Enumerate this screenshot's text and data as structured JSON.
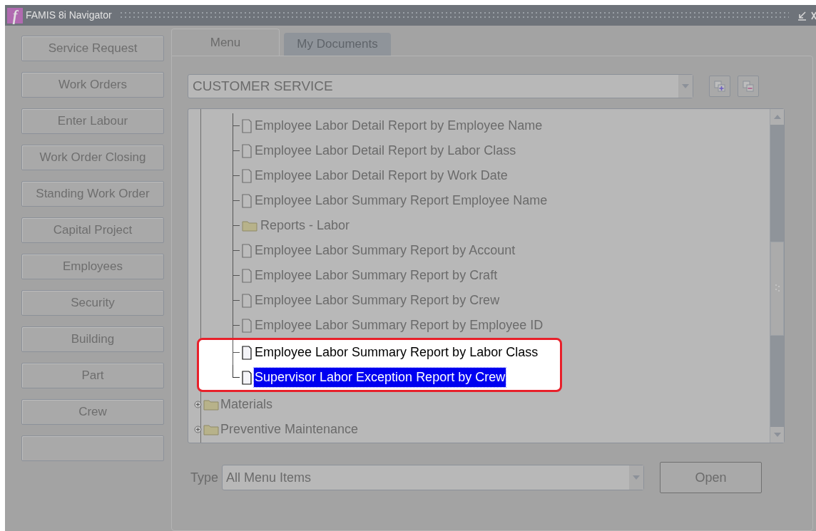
{
  "window": {
    "title": "FAMIS 8i Navigator",
    "logo": "f"
  },
  "sidebar": {
    "items": [
      {
        "kind": "button",
        "label": "Service Request"
      },
      {
        "kind": "button",
        "label": "Work Orders"
      },
      {
        "kind": "button",
        "label": "Enter Labour"
      },
      {
        "kind": "button",
        "label": "Work Order Closing"
      },
      {
        "kind": "button",
        "label": "Standing Work Order"
      },
      {
        "kind": "button",
        "label": "Capital Project"
      },
      {
        "kind": "button",
        "label": "Employees"
      },
      {
        "kind": "button",
        "label": "Security"
      },
      {
        "kind": "button",
        "label": "Building"
      },
      {
        "kind": "button",
        "label": "Part"
      },
      {
        "kind": "button",
        "label": "Crew"
      },
      {
        "kind": "blank"
      }
    ]
  },
  "tabs": [
    {
      "label": "Menu",
      "selected": true
    },
    {
      "label": "My Documents",
      "selected": false
    }
  ],
  "menu_select": {
    "value": "CUSTOMER SERVICE"
  },
  "tree": {
    "open_branch": {
      "children": [
        {
          "kind": "document",
          "label": "Employee Labor Detail Report by Employee Name",
          "highlighted": false,
          "selected": false
        },
        {
          "kind": "document",
          "label": "Employee Labor Detail Report by Labor Class",
          "highlighted": false,
          "selected": false
        },
        {
          "kind": "document",
          "label": "Employee Labor Detail Report by Work Date",
          "highlighted": false,
          "selected": false
        },
        {
          "kind": "document",
          "label": "Employee Labor Summary Report Employee Name",
          "highlighted": false,
          "selected": false
        },
        {
          "kind": "folder",
          "label": "Reports - Labor",
          "highlighted": false,
          "selected": false
        },
        {
          "kind": "document",
          "label": "Employee Labor Summary Report by Account",
          "highlighted": false,
          "selected": false
        },
        {
          "kind": "document",
          "label": "Employee Labor Summary Report by Craft",
          "highlighted": false,
          "selected": false
        },
        {
          "kind": "document",
          "label": "Employee Labor Summary Report by Crew",
          "highlighted": false,
          "selected": false
        },
        {
          "kind": "document",
          "label": "Employee Labor Summary Report by Employee ID",
          "highlighted": false,
          "selected": false
        },
        {
          "kind": "document",
          "label": "Employee Labor Summary Report by Labor Class",
          "highlighted": true,
          "selected": false
        },
        {
          "kind": "document",
          "label": "Supervisor Labor Exception Report by Crew",
          "highlighted": true,
          "selected": true
        }
      ]
    },
    "items": [
      {
        "kind": "folder",
        "label": "Materials",
        "expanded": false
      },
      {
        "kind": "folder",
        "label": "Preventive Maintenance",
        "expanded": false
      }
    ]
  },
  "type_field": {
    "label": "Type",
    "value": "All Menu Items"
  },
  "open_button": {
    "label": "Open"
  }
}
